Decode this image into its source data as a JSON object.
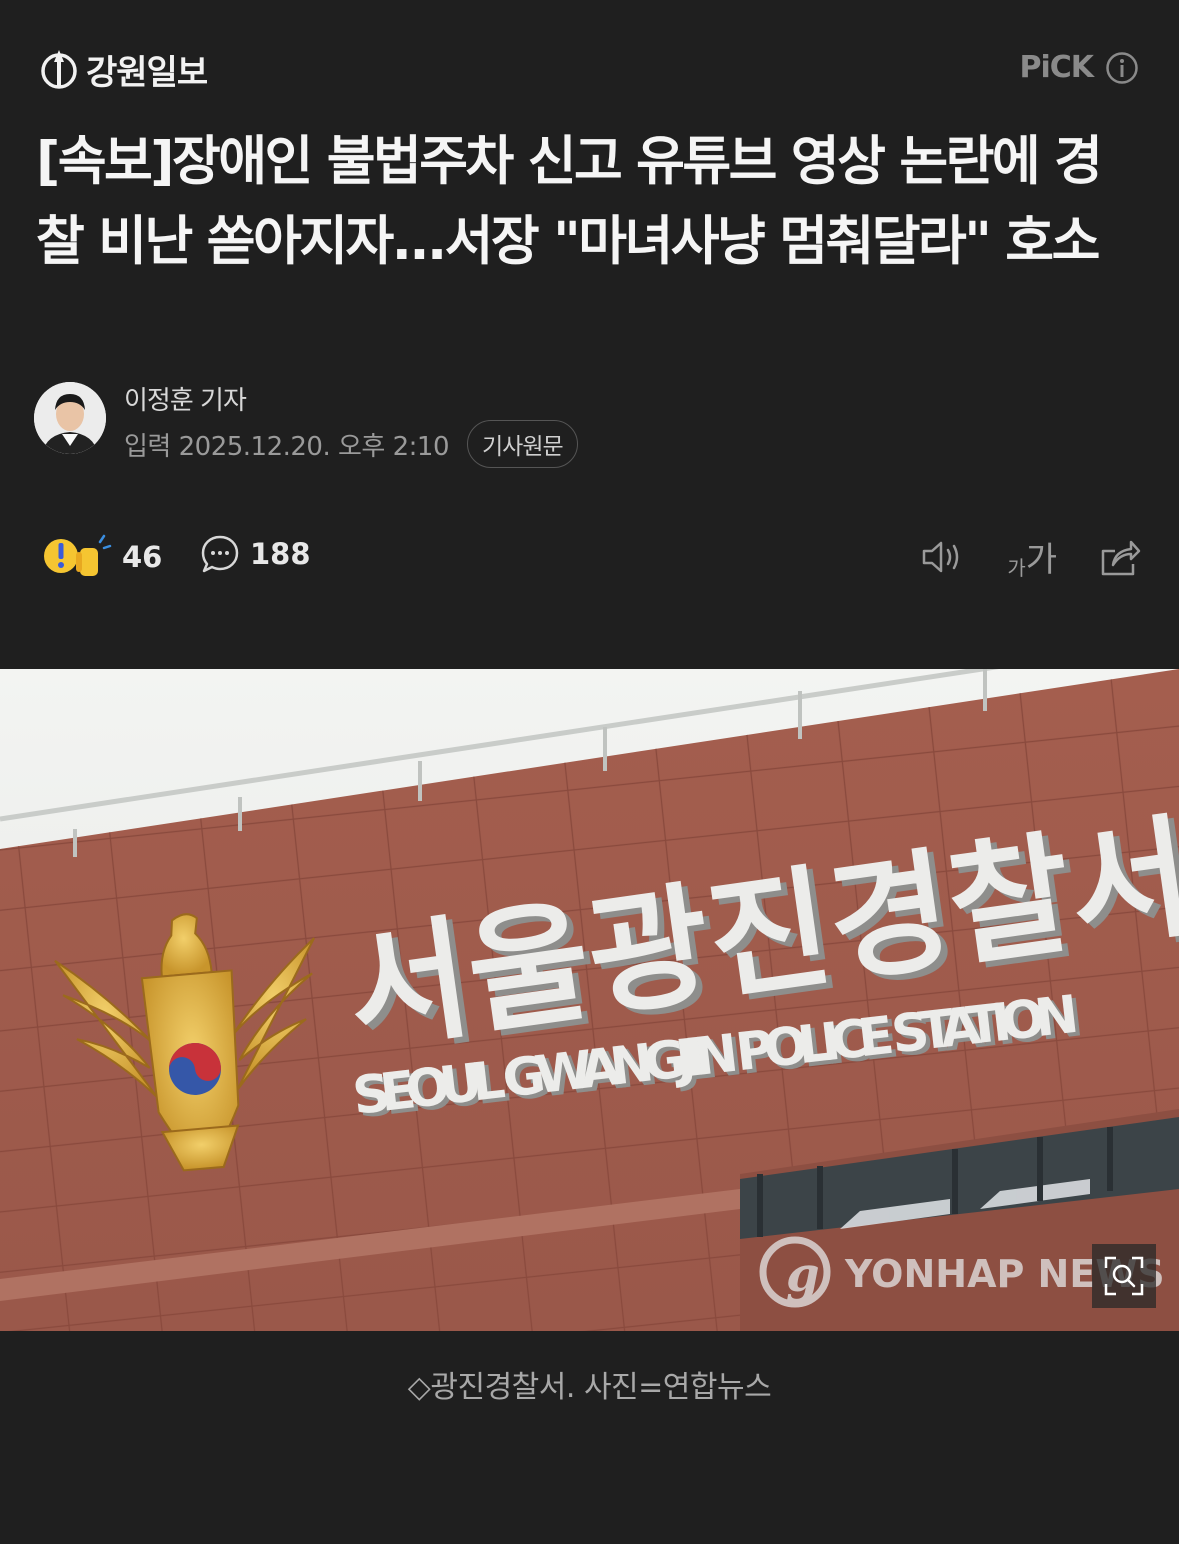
{
  "header": {
    "brand": "강원일보",
    "pick_label": "PiCK"
  },
  "article": {
    "title": "[속보]장애인 불법주차 신고 유튜브 영상 논란에 경찰 비난 쏟아지자...서장 \"마녀사냥 멈춰달라\" 호소",
    "reporter": "이정훈 기자",
    "date_label": "입력 2025.12.20. 오후 2:10",
    "original_button": "기사원문"
  },
  "actions": {
    "reaction_count": "46",
    "comment_count": "188",
    "font_small": "가",
    "font_big": "가"
  },
  "photo": {
    "sign_korean": "서울광진경찰서",
    "sign_english": "SEOUL GWANGJIN POLICE STATION",
    "watermark": "YONHAP NEWS",
    "caption": "◇광진경찰서. 사진=연합뉴스"
  },
  "icons": {
    "brand_logo": "brand-logo-icon",
    "info": "info-icon",
    "reaction": "reaction-emoji-icon",
    "comment": "comment-bubble-icon",
    "speaker": "speaker-icon",
    "share": "share-icon",
    "zoom": "zoom-icon"
  },
  "colors": {
    "background": "#1f1f1f",
    "title": "#f5f5f5",
    "muted": "#9a9a9a"
  }
}
